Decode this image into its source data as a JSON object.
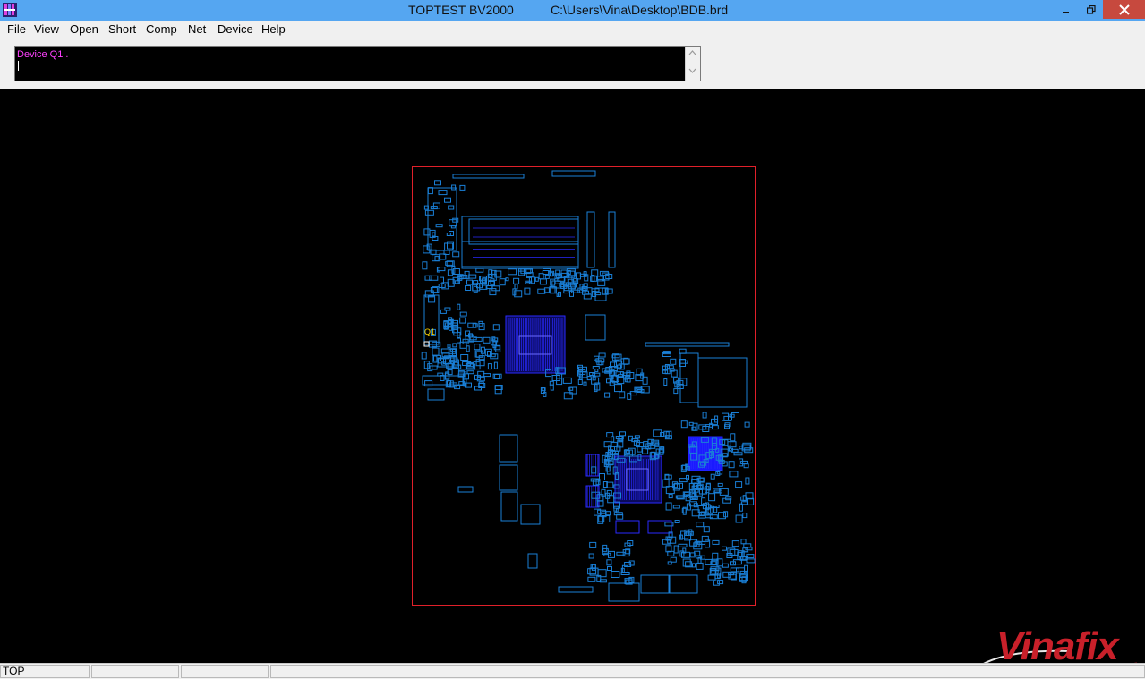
{
  "window": {
    "app_title": "TOPTEST BV2000",
    "file_path": "C:\\Users\\Vina\\Desktop\\BDB.brd",
    "minimize_icon": "minimize-icon",
    "maximize_icon": "restore-icon",
    "close_icon": "close-icon"
  },
  "menu": {
    "items": [
      "File",
      "View",
      "Open",
      "Short",
      "Comp",
      "Net",
      "Device",
      "Help"
    ]
  },
  "console": {
    "text": "Device Q1 .",
    "text_color": "#ff40ff"
  },
  "board": {
    "outline_color": "#e0202a",
    "trace_color": "#1a7fd6",
    "selected_device": "Q1",
    "selected_color": "#ffd700"
  },
  "watermark": {
    "text": "Vinafix",
    "color": "#c8202a"
  },
  "statusbar": {
    "panes": [
      "TOP",
      "",
      "",
      ""
    ]
  },
  "colors": {
    "titlebar": "#55a6f1",
    "close_button": "#c7493e",
    "background": "#000000"
  }
}
